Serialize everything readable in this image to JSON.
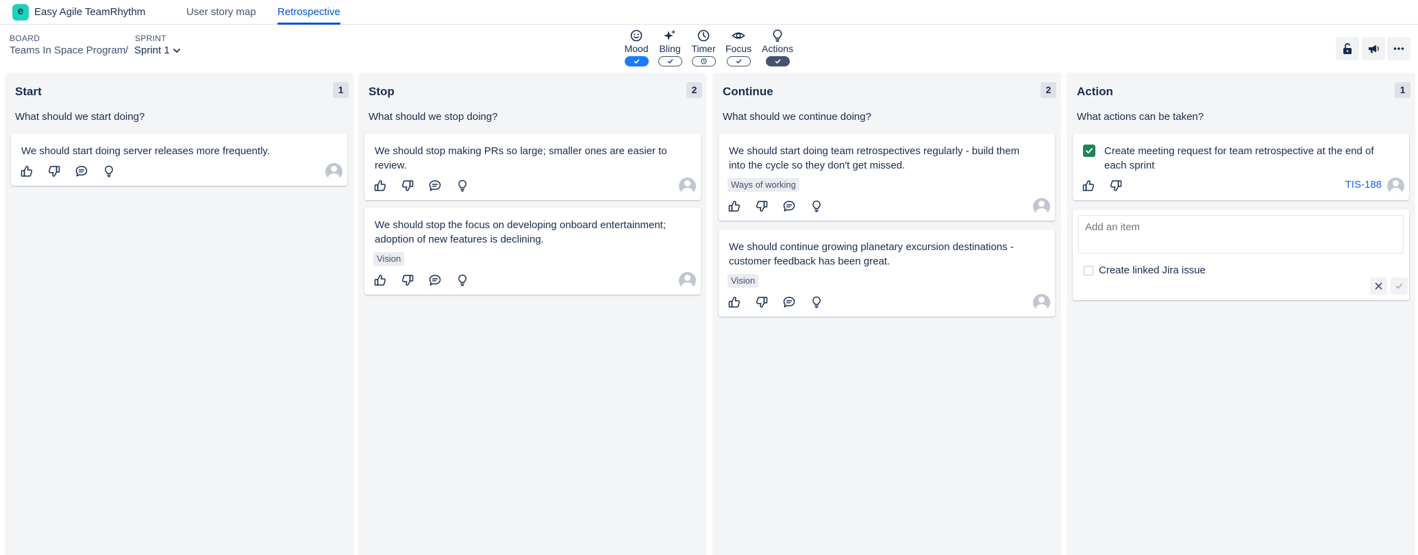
{
  "topnav": {
    "logo_letter": "e",
    "app_name": "Easy Agile TeamRhythm",
    "tabs": [
      {
        "label": "User story map",
        "active": false
      },
      {
        "label": "Retrospective",
        "active": true
      }
    ]
  },
  "context": {
    "board_label": "BOARD",
    "board_value": "Teams In Space Program",
    "separator": "/",
    "sprint_label": "SPRINT",
    "sprint_value": "Sprint 1"
  },
  "toolbar": {
    "tools": [
      {
        "name": "Mood",
        "icon": "smile-icon",
        "state": "on"
      },
      {
        "name": "Bling",
        "icon": "sparkle-icon",
        "state": "off"
      },
      {
        "name": "Timer",
        "icon": "clock-icon",
        "state": "off"
      },
      {
        "name": "Focus",
        "icon": "eye-icon",
        "state": "off"
      },
      {
        "name": "Actions",
        "icon": "lightbulb-icon",
        "state": "dark"
      }
    ],
    "right_buttons": [
      "unlock-icon",
      "megaphone-icon",
      "more-icon"
    ]
  },
  "columns": [
    {
      "title": "Start",
      "count": "1",
      "question": "What should we start doing?",
      "cards": [
        {
          "text": "We should start doing server releases more frequently.",
          "tag": ""
        }
      ]
    },
    {
      "title": "Stop",
      "count": "2",
      "question": "What should we stop doing?",
      "cards": [
        {
          "text": "We should stop making PRs so large; smaller ones are easier to review.",
          "tag": ""
        },
        {
          "text": "We should stop the focus on developing onboard entertainment; adoption of new features is declining.",
          "tag": "Vision"
        }
      ]
    },
    {
      "title": "Continue",
      "count": "2",
      "question": "What should we continue doing?",
      "cards": [
        {
          "text": "We should start doing team retrospectives regularly - build them into the cycle so they don't get missed.",
          "tag": "Ways of working"
        },
        {
          "text": "We should continue growing planetary excursion destinations - customer feedback has been great.",
          "tag": "Vision"
        }
      ]
    },
    {
      "title": "Action",
      "count": "1",
      "question": "What actions can be taken?",
      "cards": [
        {
          "text": "Create meeting request for team retrospective at the end of each sprint",
          "done": true,
          "issue_key": "TIS-188"
        }
      ],
      "add_item": {
        "placeholder": "Add an item",
        "linked_label": "Create linked Jira issue"
      }
    }
  ],
  "colors": {
    "accent": "#0052cc",
    "mood_on": "#1d7afc",
    "actions_on": "#44546f",
    "done_check": "#1f845a",
    "column_bg": "#f4f5f7",
    "logo": "#1fd1b9"
  }
}
